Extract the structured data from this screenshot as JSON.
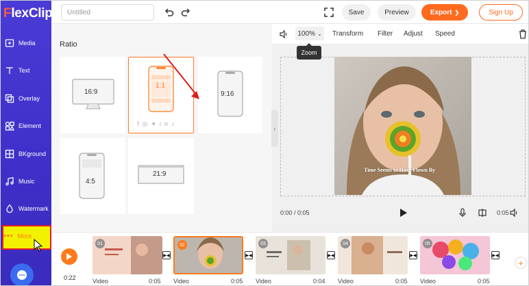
{
  "app": {
    "logo_text": "FlexClip",
    "logo_first": "F",
    "logo_rest": "lexClip",
    "brand_color": "#ff6a1f",
    "sidebar_color": "#4535d0"
  },
  "sidebar": {
    "items": [
      {
        "label": "Media",
        "icon": "media-icon"
      },
      {
        "label": "Text",
        "icon": "text-icon"
      },
      {
        "label": "Overlay",
        "icon": "overlay-icon"
      },
      {
        "label": "Element",
        "icon": "element-icon"
      },
      {
        "label": "BKground",
        "icon": "background-icon"
      },
      {
        "label": "Music",
        "icon": "music-icon"
      },
      {
        "label": "Watermark",
        "icon": "watermark-icon"
      },
      {
        "label": "More",
        "icon": "more-icon"
      }
    ]
  },
  "topbar": {
    "title_placeholder": "Untitled",
    "save_label": "Save",
    "preview_label": "Preview",
    "export_label": "Export",
    "signup_label": "Sign Up"
  },
  "ratio_panel": {
    "title": "Ratio",
    "options": [
      "16:9",
      "1:1",
      "9:16",
      "4:5",
      "21:9"
    ],
    "selected": "1:1"
  },
  "preview_toolbar": {
    "zoom_value": "100%",
    "zoom_tooltip": "Zoom",
    "transform_label": "Transform",
    "filter_label": "Filter",
    "adjust_label": "Adjust",
    "speed_label": "Speed"
  },
  "preview": {
    "caption": "Time Seems to Have Flown By",
    "time_position": "0:00 / 0:05",
    "duration": "0:05"
  },
  "timeline": {
    "current_time": "0:22",
    "clips": [
      {
        "num": "01",
        "label": "Video",
        "duration": "0:05"
      },
      {
        "num": "02",
        "label": "Video",
        "duration": "0:05"
      },
      {
        "num": "03",
        "label": "Video",
        "duration": "0:04"
      },
      {
        "num": "04",
        "label": "Video",
        "duration": "0:05"
      },
      {
        "num": "05",
        "label": "Video",
        "duration": "0:05"
      }
    ]
  }
}
